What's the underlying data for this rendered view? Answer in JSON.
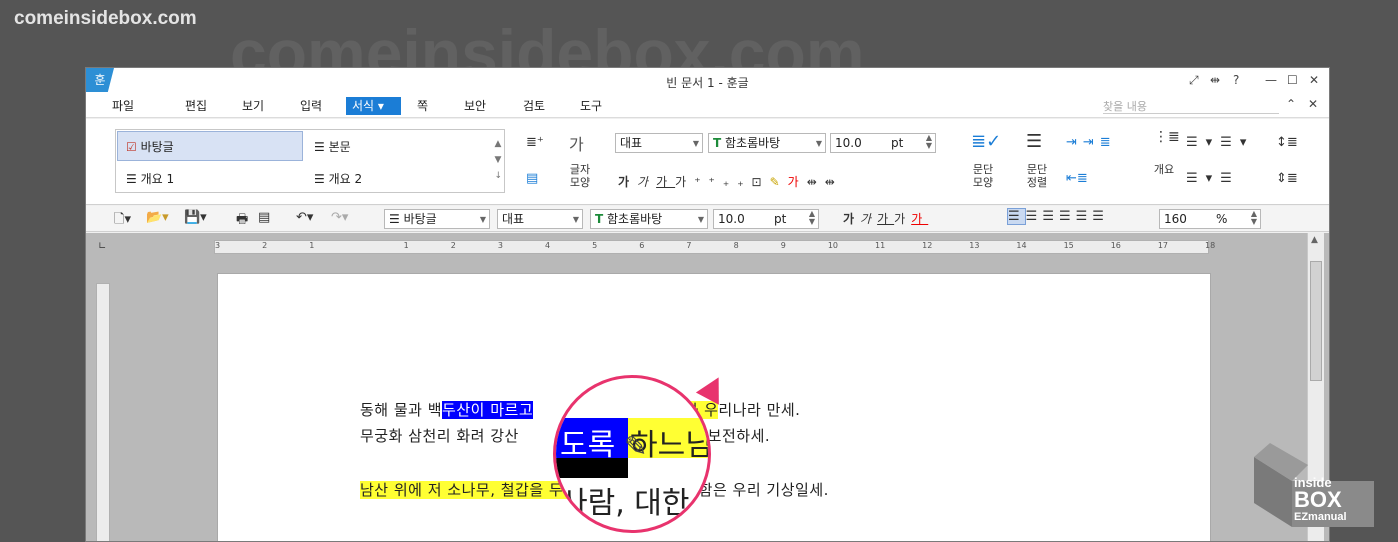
{
  "site": "comeinsidebox.com",
  "window": {
    "app_icon": "훈",
    "title": "빈 문서 1 - 훈글",
    "question": "?"
  },
  "menu": {
    "items": [
      "파일",
      "편집",
      "보기",
      "입력",
      "서식",
      "쪽",
      "보안",
      "검토",
      "도구"
    ],
    "active": "서식",
    "search_placeholder": "찾을 내용"
  },
  "ribbon": {
    "styles": [
      "바탕글",
      "본문",
      "개요 1",
      "개요 2"
    ],
    "char_shape_label": "글자\n모양",
    "para_shape_label": "문단\n모양",
    "para_align_label": "문단\n정렬",
    "outline_label": "개요",
    "lang": "대표",
    "font": "함초롬바탕",
    "size": "10.0",
    "unit": "pt"
  },
  "toolbar2": {
    "style": "바탕글",
    "lang": "대표",
    "font": "함초롬바탕",
    "size": "10.0",
    "unit": "pt",
    "zoom": "160",
    "zoom_unit": "%"
  },
  "ruler": {
    "ticks": [
      "3",
      "2",
      "1",
      "",
      "1",
      "2",
      "3",
      "4",
      "5",
      "6",
      "7",
      "8",
      "9",
      "10",
      "11",
      "12",
      "13",
      "14",
      "15",
      "16",
      "17",
      "18"
    ]
  },
  "document": {
    "line1_a": "동해 물과 백",
    "line1_b": "두산이 마르고",
    "line1_c": "보우하사 우",
    "line1_d": "리나라 만세.",
    "line2_a": "무궁화 삼천리 화려 강산",
    "line2_b": "길이 보전하세.",
    "line3_a": "남산 위에 저 소나무, 철갑을 두른 듯 바람 서",
    "line3_b": "리 불변함은 우리 기상일세."
  },
  "magnifier": {
    "line1_blue": "도록",
    "line1_yellow": "하느님",
    "line2": "사람, 대한"
  },
  "brand": {
    "line1": "inside",
    "line2": "BOX",
    "line3": "EZmanual"
  },
  "colors": {
    "accent": "#1b7dd6",
    "highlight_yellow": "#ffff33",
    "selection_blue": "#0000ff",
    "pointer_pink": "#e8336d"
  }
}
